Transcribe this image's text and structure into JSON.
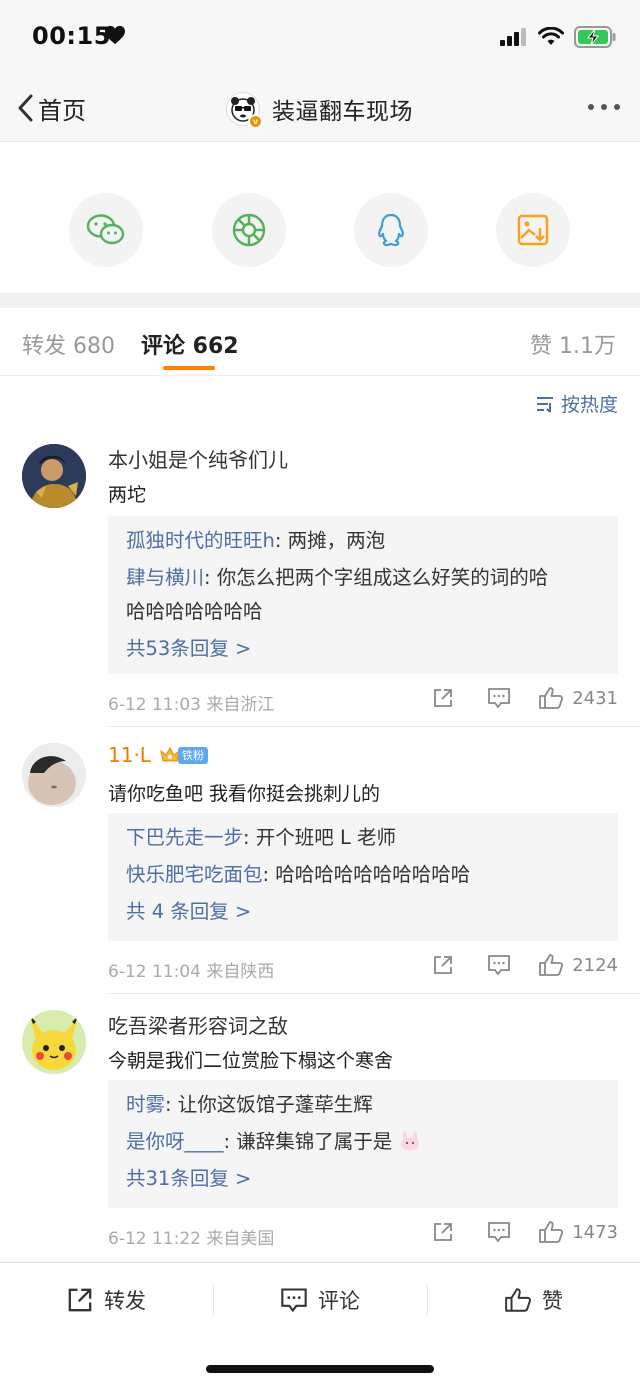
{
  "status": {
    "time": "00:15"
  },
  "header": {
    "back_label": "首页",
    "title": "装逼翻车现场",
    "verified_badge": "v"
  },
  "share": {
    "items": [
      {
        "icon": "wechat-icon",
        "color": "#55b05a"
      },
      {
        "icon": "moments-icon",
        "color": "#55b05a"
      },
      {
        "icon": "qq-icon",
        "color": "#3d9bd6"
      },
      {
        "icon": "save-image-icon",
        "color": "#f3a21b"
      }
    ]
  },
  "tabs": {
    "repost": "转发 680",
    "comment": "评论 662",
    "like": "赞 1.1万"
  },
  "sort_label": "按热度",
  "comments": [
    {
      "user": "本小姐是个纯爷们儿",
      "text": "两坨",
      "replies": [
        {
          "name": "孤独时代的旺旺h",
          "text": ": 两摊，两泡"
        },
        {
          "name": "肆与横川",
          "text": ": 你怎么把两个字组成这么好笑的词的哈",
          "text2": "哈哈哈哈哈哈哈"
        }
      ],
      "more": "共53条回复 >",
      "time": "6-12 11:03",
      "from": "来自浙江",
      "likes": "2431"
    },
    {
      "user": "11·L",
      "badge": "铁粉",
      "text": "请你吃鱼吧 我看你挺会挑刺儿的",
      "replies": [
        {
          "name": "下巴先走一步",
          "text": ": 开个班吧 L 老师"
        },
        {
          "name": "快乐肥宅吃面包",
          "text": ": 哈哈哈哈哈哈哈哈哈哈"
        }
      ],
      "more": "共 4 条回复 >",
      "time": "6-12 11:04",
      "from": "来自陕西",
      "likes": "2124"
    },
    {
      "user": "吃吾梁者形容词之敌",
      "text": "今朝是我们二位赏脸下榻这个寒舍",
      "replies": [
        {
          "name": "时雾",
          "text": ": 让你这饭馆子蓬荜生辉"
        },
        {
          "name": "是你呀____",
          "text": ": 谦辞集锦了属于是"
        }
      ],
      "more": "共31条回复 >",
      "time": "6-12 11:22",
      "from": "来自美国",
      "likes": "1473"
    }
  ],
  "bottom": {
    "repost": "转发",
    "comment": "评论",
    "like": "赞"
  },
  "colors": {
    "accent": "#ff8200",
    "link": "#4e6fa3",
    "badge": "#5fa8f0"
  }
}
